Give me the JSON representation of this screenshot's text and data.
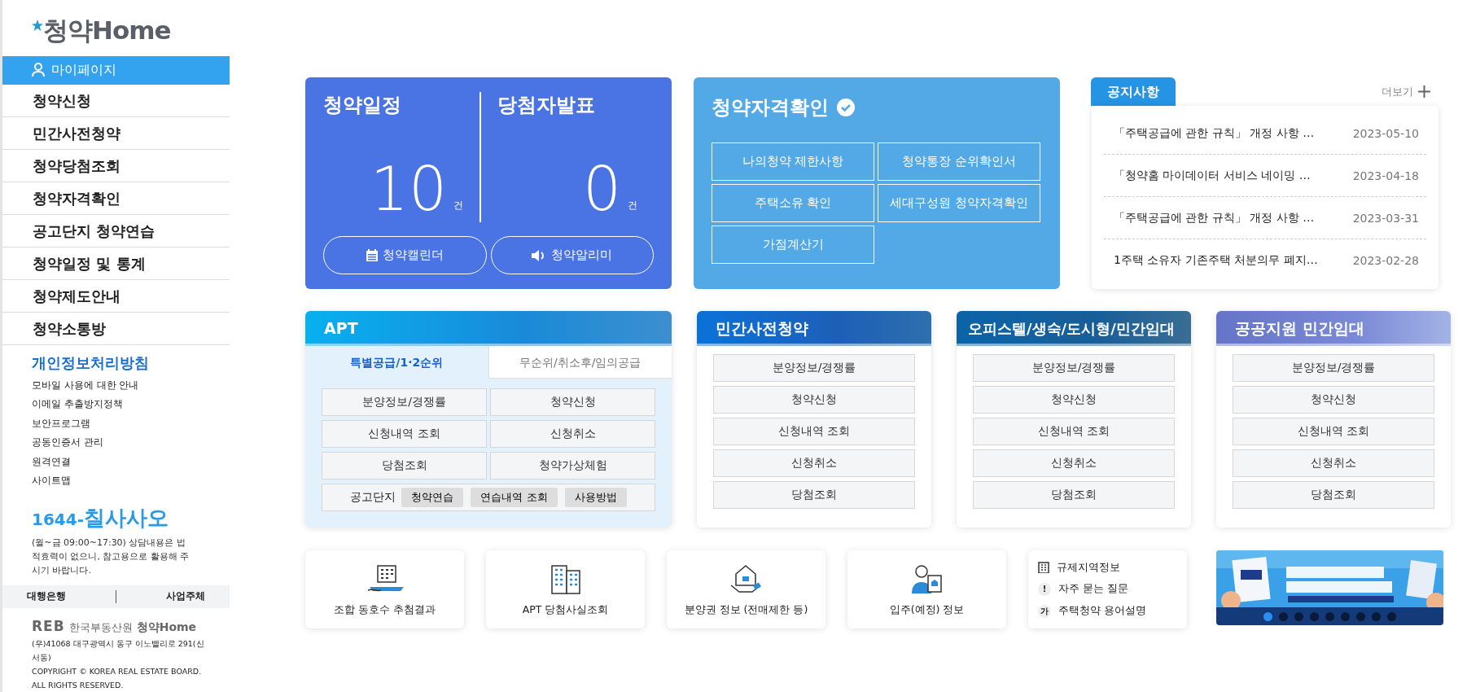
{
  "sidebar": {
    "logo": "청약Home",
    "mypage": {
      "label": "마이페이지",
      "selected": true
    },
    "nav": [
      {
        "label": "청약신청"
      },
      {
        "label": "민간사전청약"
      },
      {
        "label": "청약당첨조회"
      },
      {
        "label": "청약자격확인"
      },
      {
        "label": "공고단지 청약연습"
      },
      {
        "label": "청약일정 및 통계"
      },
      {
        "label": "청약제도안내"
      },
      {
        "label": "청약소통방"
      }
    ],
    "policy_title": "개인정보처리방침",
    "links": [
      "모바일 사용에 대한 안내",
      "이메일 추출방지정책",
      "보안프로그램",
      "공동인증서 관리",
      "원격연결",
      "사이트맵"
    ],
    "phone_prefix": "1644-",
    "phone_word": "칠사사오",
    "hours_note": "(월~금 09:00~17:30) 상담내용은 법적효력이 없으니, 참고용으로 활용해 주시기 바랍니다.",
    "footer_links": [
      "대행은행",
      "사업주체"
    ],
    "footer_logo": {
      "mark": "REB",
      "org": "한국부동산원",
      "site": "청약Home"
    },
    "address": "(우)41068 대구광역시 동구 이노밸리로 291(신서동)",
    "copyright": "COPYRIGHT © KOREA REAL ESTATE BOARD. ALL RIGHTS RESERVED."
  },
  "schedule_card": {
    "stats": [
      {
        "title": "청약일정",
        "count": "10",
        "unit": "건"
      },
      {
        "title": "당첨자발표",
        "count": "0",
        "unit": "건"
      }
    ],
    "buttons": [
      {
        "label": "청약캘린더",
        "kind": "calendar"
      },
      {
        "label": "청약알리미",
        "kind": "speaker"
      }
    ]
  },
  "eligibility_card": {
    "title": "청약자격확인",
    "buttons": [
      "나의청약 제한사항",
      "청약통장 순위확인서",
      "주택소유 확인",
      "세대구성원 청약자격확인",
      "가점계산기"
    ]
  },
  "notices": {
    "tab": "공지사항",
    "more": "더보기",
    "items": [
      {
        "title": "「주택공급에 관한 규칙」 개정 사항 …",
        "date": "2023-05-10"
      },
      {
        "title": "「청약홈 마이데이터 서비스 네이밍 …",
        "date": "2023-04-18"
      },
      {
        "title": "「주택공급에 관한 규칙」 개정 사항 …",
        "date": "2023-03-31"
      },
      {
        "title": "1주택 소유자 기존주택 처분의무 폐지…",
        "date": "2023-02-28"
      }
    ]
  },
  "categories": [
    {
      "title": "APT",
      "kind": "apt",
      "tabs": [
        {
          "label": "특별공급/1·2순위",
          "selected": true
        },
        {
          "label": "무순위/취소후/임의공급",
          "selected": false
        }
      ],
      "buttons": [
        "분양정보/경쟁률",
        "청약신청",
        "신청내역 조회",
        "신청취소",
        "당첨조회",
        "청약가상체험"
      ],
      "practice": {
        "label": "공고단지",
        "chips": [
          "청약연습",
          "연습내역 조회",
          "사용방법"
        ]
      }
    },
    {
      "title": "민간사전청약",
      "kind": "presale",
      "buttons": [
        "분양정보/경쟁률",
        "청약신청",
        "신청내역 조회",
        "신청취소",
        "당첨조회"
      ]
    },
    {
      "title": "오피스텔/생숙/도시형/민간임대",
      "kind": "officetel",
      "buttons": [
        "분양정보/경쟁률",
        "청약신청",
        "신청내역 조회",
        "신청취소",
        "당첨조회"
      ]
    },
    {
      "title": "공공지원 민간임대",
      "kind": "public",
      "buttons": [
        "분양정보/경쟁률",
        "청약신청",
        "신청내역 조회",
        "신청취소",
        "당첨조회"
      ]
    }
  ],
  "quick_links": [
    {
      "label": "조합 동호수 추첨결과",
      "kind": "lottery"
    },
    {
      "label": "APT 당첨사실조회",
      "kind": "apartment"
    },
    {
      "label": "분양권 정보 (전매제한 등)",
      "kind": "house"
    },
    {
      "label": "입주(예정) 정보",
      "kind": "resident"
    }
  ],
  "info_links": [
    {
      "label": "규제지역정보",
      "kind": "building"
    },
    {
      "label": "자주 묻는 질문",
      "kind": "glyph",
      "glyph": "!"
    },
    {
      "label": "주택청약 용어설명",
      "kind": "glyph",
      "glyph": "가"
    }
  ],
  "banner": {
    "kind": "picture",
    "dots": [
      {
        "selected": true
      },
      {
        "selected": false
      },
      {
        "selected": false
      },
      {
        "selected": false
      },
      {
        "selected": false
      },
      {
        "selected": false
      },
      {
        "selected": false
      },
      {
        "selected": false
      },
      {
        "selected": false
      }
    ]
  }
}
